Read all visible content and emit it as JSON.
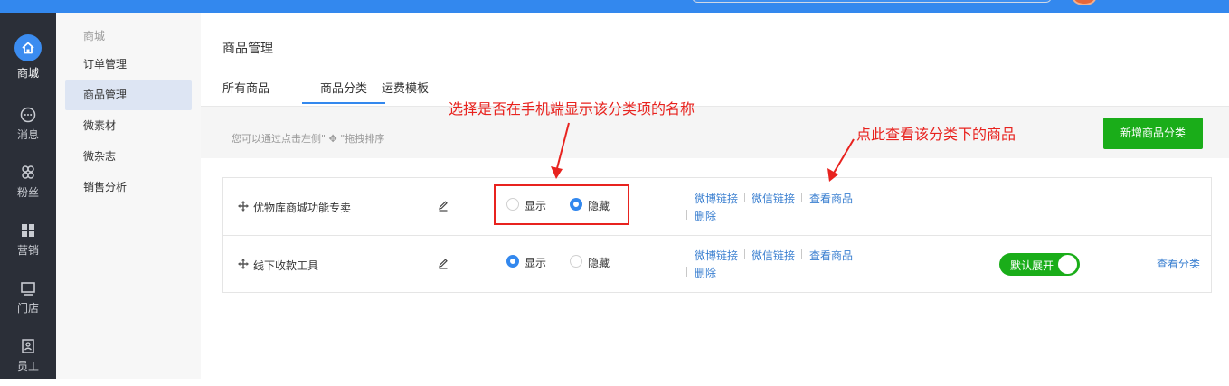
{
  "rail": {
    "items": [
      {
        "label": "商城",
        "icon": "home-icon",
        "active": true
      },
      {
        "label": "消息",
        "icon": "chat-icon"
      },
      {
        "label": "粉丝",
        "icon": "fans-icon"
      },
      {
        "label": "营销",
        "icon": "grid-icon"
      },
      {
        "label": "门店",
        "icon": "monitor-icon"
      },
      {
        "label": "员工",
        "icon": "staff-icon"
      }
    ]
  },
  "subnav": {
    "group": "商城",
    "items": [
      "订单管理",
      "商品管理",
      "微素材",
      "微杂志",
      "销售分析"
    ],
    "active": "商品管理"
  },
  "page": {
    "title": "商品管理",
    "tabs": [
      "所有商品",
      "商品分类",
      "运费模板"
    ],
    "active_tab": "商品分类"
  },
  "toolbar": {
    "hint": "您可以通过点击左侧\" ✥ \"拖拽排序",
    "add_button": "新增商品分类"
  },
  "table": {
    "rows": [
      {
        "name": "优物库商城功能专卖",
        "show_label": "显示",
        "hide_label": "隐藏",
        "selected": "隐藏",
        "links": [
          "微博链接",
          "微信链接",
          "查看商品"
        ],
        "delete": "删除"
      },
      {
        "name": "线下收款工具",
        "show_label": "显示",
        "hide_label": "隐藏",
        "selected": "显示",
        "links": [
          "微博链接",
          "微信链接",
          "查看商品"
        ],
        "delete": "删除",
        "toggle_label": "默认展开",
        "view_category": "查看分类"
      }
    ]
  },
  "annotations": {
    "note1": "选择是否在手机端显示该分类项的名称",
    "note2": "点此查看该分类下的商品",
    "color": "#e8231f"
  },
  "colors": {
    "accent": "#3388ee",
    "primary_button": "#1aad19",
    "rail_bg": "#2b2f38",
    "link": "#3a7fd0"
  }
}
